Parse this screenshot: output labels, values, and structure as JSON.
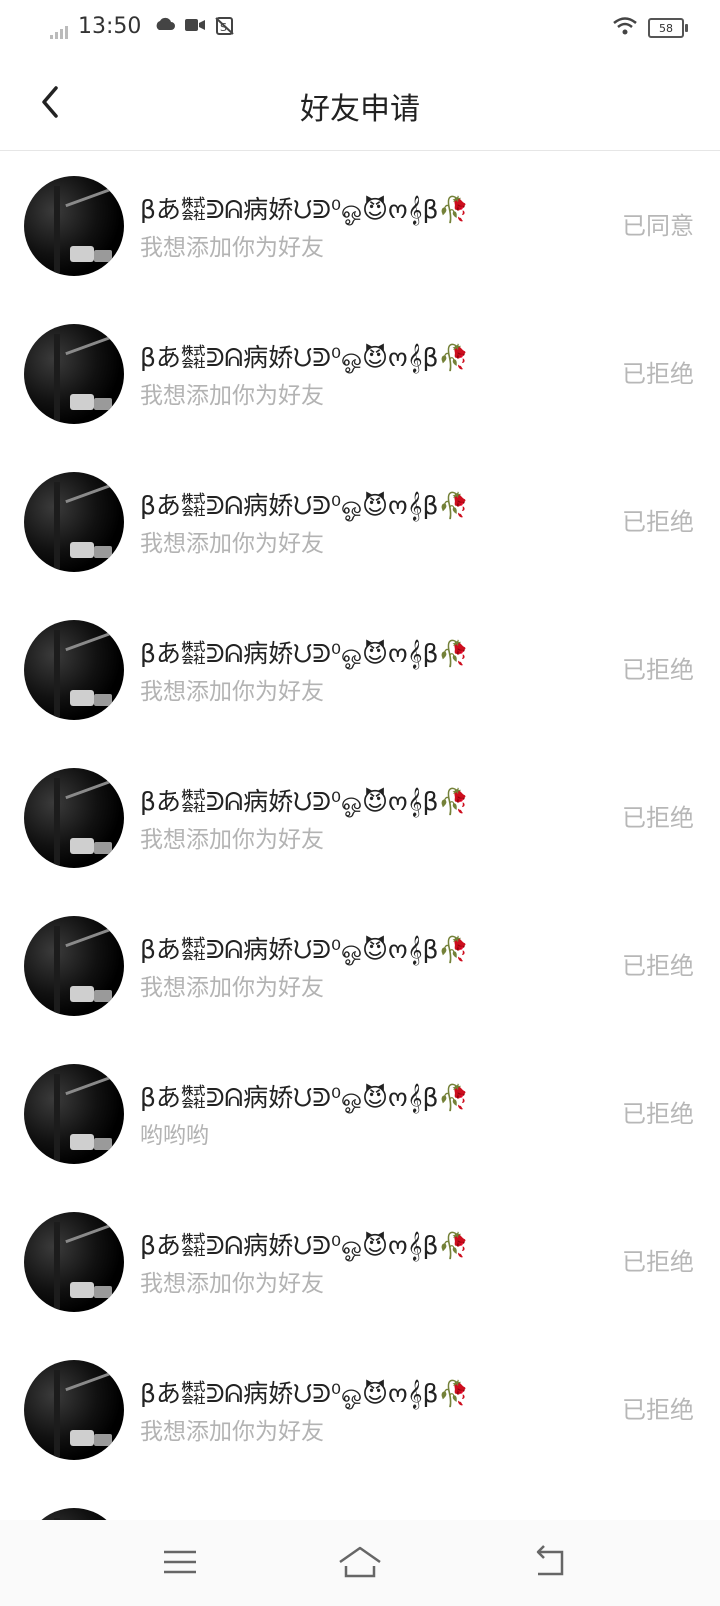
{
  "status_bar": {
    "time": "13:50",
    "battery": "58",
    "icons": [
      "signal-icon",
      "cloud-icon",
      "video-icon",
      "sim-icon",
      "wifi-icon",
      "battery-icon"
    ]
  },
  "header": {
    "title": "好友申请",
    "back_icon": "chevron-left-icon"
  },
  "requests": [
    {
      "name": "βあ㍿ᕲᕱ病娇ᙀᕲ⁰ஓ😈ო𝄞β🥀",
      "message": "我想添加你为好友",
      "status": "已同意"
    },
    {
      "name": "βあ㍿ᕲᕱ病娇ᙀᕲ⁰ஓ😈ო𝄞β🥀",
      "message": "我想添加你为好友",
      "status": "已拒绝"
    },
    {
      "name": "βあ㍿ᕲᕱ病娇ᙀᕲ⁰ஓ😈ო𝄞β🥀",
      "message": "我想添加你为好友",
      "status": "已拒绝"
    },
    {
      "name": "βあ㍿ᕲᕱ病娇ᙀᕲ⁰ஓ😈ო𝄞β🥀",
      "message": "我想添加你为好友",
      "status": "已拒绝"
    },
    {
      "name": "βあ㍿ᕲᕱ病娇ᙀᕲ⁰ஓ😈ო𝄞β🥀",
      "message": "我想添加你为好友",
      "status": "已拒绝"
    },
    {
      "name": "βあ㍿ᕲᕱ病娇ᙀᕲ⁰ஓ😈ო𝄞β🥀",
      "message": "我想添加你为好友",
      "status": "已拒绝"
    },
    {
      "name": "βあ㍿ᕲᕱ病娇ᙀᕲ⁰ஓ😈ო𝄞β🥀",
      "message": "哟哟哟",
      "status": "已拒绝"
    },
    {
      "name": "βあ㍿ᕲᕱ病娇ᙀᕲ⁰ஓ😈ო𝄞β🥀",
      "message": "我想添加你为好友",
      "status": "已拒绝"
    },
    {
      "name": "βあ㍿ᕲᕱ病娇ᙀᕲ⁰ஓ😈ო𝄞β🥀",
      "message": "我想添加你为好友",
      "status": "已拒绝"
    },
    {
      "name": "",
      "message": "",
      "status": ""
    }
  ],
  "nav_bar": {
    "icons": [
      "menu-icon",
      "home-icon",
      "back-icon"
    ]
  }
}
